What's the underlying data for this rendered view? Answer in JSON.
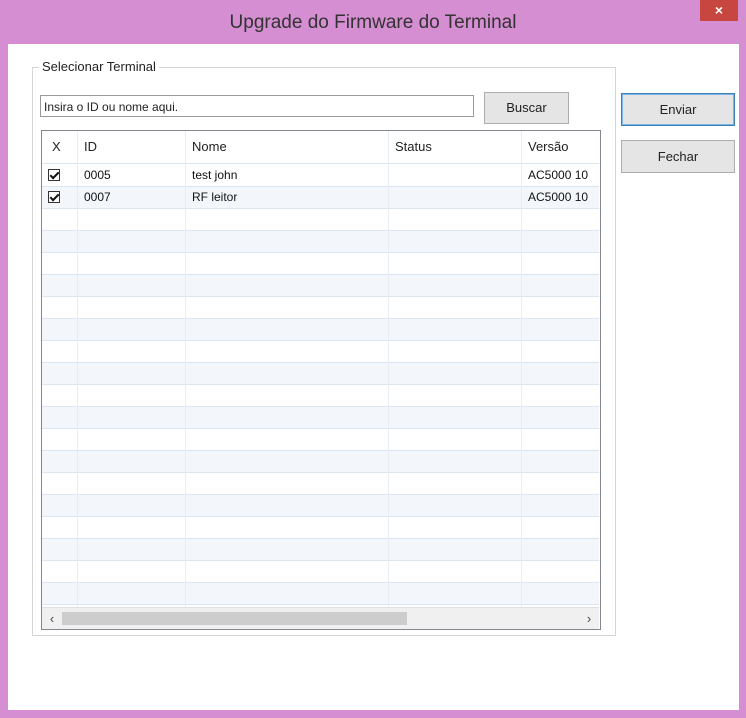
{
  "window": {
    "title": "Upgrade do Firmware do Terminal",
    "close_glyph": "×"
  },
  "group": {
    "legend": "Selecionar Terminal"
  },
  "search": {
    "value": "Insira o ID ou nome aqui.",
    "button_label": "Buscar"
  },
  "actions": {
    "send_label": "Enviar",
    "close_label": "Fechar"
  },
  "table": {
    "columns": [
      "X",
      "ID",
      "Nome",
      "Status",
      "Versão"
    ],
    "rows": [
      {
        "checked": true,
        "id": "0005",
        "name": "test john",
        "status": "",
        "version": "AC5000 10"
      },
      {
        "checked": true,
        "id": "0007",
        "name": "RF leitor",
        "status": "",
        "version": "AC5000 10"
      }
    ]
  },
  "scrollbar": {
    "left_arrow": "‹",
    "right_arrow": "›"
  }
}
